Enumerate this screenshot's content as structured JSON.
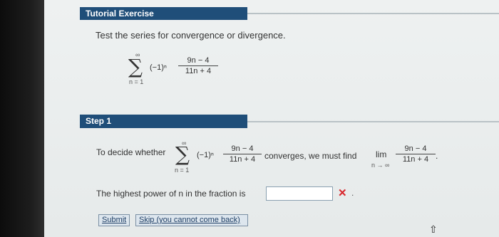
{
  "tutorial": {
    "title": "Tutorial Exercise"
  },
  "question": {
    "text": "Test the series for convergence or divergence.",
    "series": {
      "upper": "∞",
      "lower": "n = 1",
      "sign": "(−1)ⁿ",
      "numerator": "9n − 4",
      "denominator": "11n + 4"
    }
  },
  "step": {
    "label": "Step 1",
    "intro": "To decide whether",
    "series": {
      "upper": "∞",
      "lower": "n = 1",
      "sign": "(−1)ⁿ",
      "numerator": "9n − 4",
      "denominator": "11n + 4"
    },
    "middle": "converges, we must find",
    "limit": {
      "lim": "lim",
      "sub": "n → ∞",
      "numerator": "9n − 4",
      "denominator": "11n + 4",
      "tail": "."
    },
    "highest_power": {
      "label": "The highest power of n in the fraction is",
      "value": "",
      "status_mark": "✕",
      "tail": "."
    }
  },
  "buttons": {
    "submit": "Submit",
    "skip": "Skip (you cannot come back)"
  }
}
